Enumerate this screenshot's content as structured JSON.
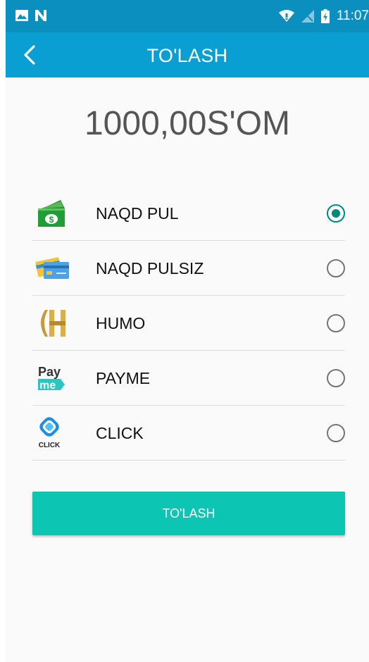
{
  "status_bar": {
    "time": "11:07",
    "icons": [
      "image-icon",
      "n-icon",
      "wifi-icon",
      "signal-icon",
      "battery-icon"
    ]
  },
  "app_bar": {
    "title": "TO'LASH",
    "back_icon": "chevron-left-icon"
  },
  "amount": "1000,00S'OM",
  "methods": [
    {
      "label": "NAQD PUL",
      "icon": "cash-icon",
      "selected": true
    },
    {
      "label": "NAQD PULSIZ",
      "icon": "cards-icon",
      "selected": false
    },
    {
      "label": "HUMO",
      "icon": "humo-logo-icon",
      "selected": false
    },
    {
      "label": "PAYME",
      "icon": "payme-logo-icon",
      "selected": false,
      "icon_text": [
        "Pay",
        "me"
      ]
    },
    {
      "label": "CLICK",
      "icon": "click-logo-icon",
      "selected": false,
      "icon_text": [
        "CLICK"
      ]
    }
  ],
  "pay_button": "TO'LASH",
  "colors": {
    "status_bar": "#0a8fbf",
    "app_bar": "#0a9fd3",
    "accent": "#00897b",
    "button": "#0dc5b3"
  }
}
